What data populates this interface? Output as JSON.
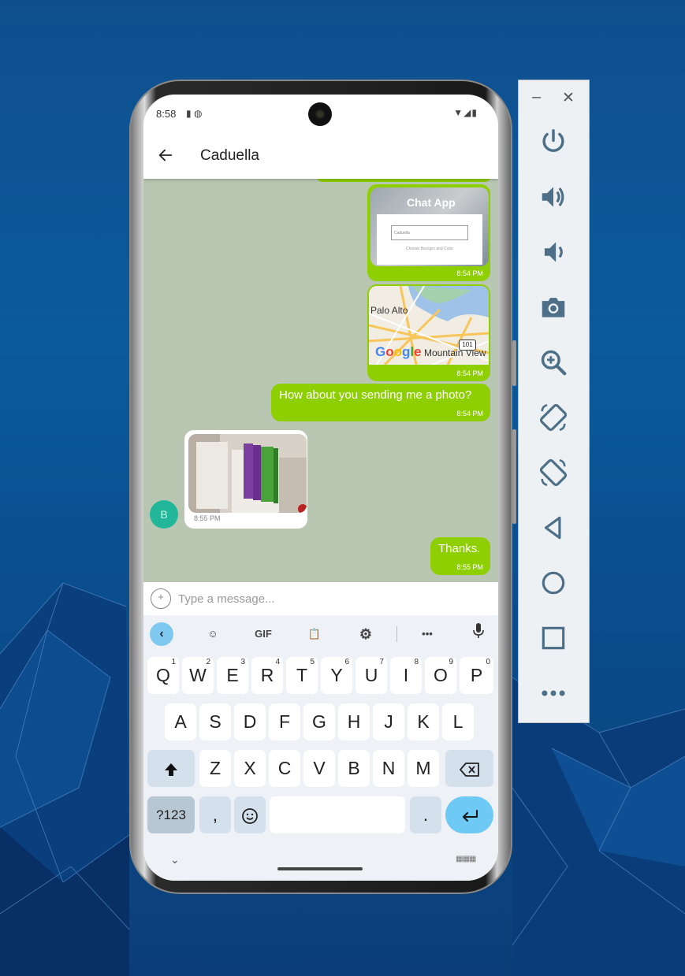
{
  "status_bar": {
    "time": "8:58"
  },
  "chat": {
    "title": "Caduella",
    "messages": [
      {
        "type": "image",
        "direction": "out",
        "caption_title": "Chat App",
        "caption_field": "Caduella",
        "caption_hint": "Choose Backgro and Color",
        "time": "8:54 PM"
      },
      {
        "type": "map",
        "direction": "out",
        "labels": [
          "Palo Alto",
          "Mountain View",
          "101",
          "Google"
        ],
        "time": "8:54 PM"
      },
      {
        "type": "text",
        "direction": "out",
        "text": "How about you sending me a photo?",
        "time": "8:54 PM"
      },
      {
        "type": "image",
        "direction": "in",
        "time": "8:55 PM"
      },
      {
        "type": "text",
        "direction": "out",
        "text": "Thanks.",
        "time": "8:55 PM"
      }
    ],
    "avatar_initial": "B"
  },
  "input": {
    "placeholder": "Type a message..."
  },
  "keyboard": {
    "toolbar": {
      "gif_label": "GIF"
    },
    "row1": [
      {
        "key": "Q",
        "hint": "1"
      },
      {
        "key": "W",
        "hint": "2"
      },
      {
        "key": "E",
        "hint": "3"
      },
      {
        "key": "R",
        "hint": "4"
      },
      {
        "key": "T",
        "hint": "5"
      },
      {
        "key": "Y",
        "hint": "6"
      },
      {
        "key": "U",
        "hint": "7"
      },
      {
        "key": "I",
        "hint": "8"
      },
      {
        "key": "O",
        "hint": "9"
      },
      {
        "key": "P",
        "hint": "0"
      }
    ],
    "row2": [
      "A",
      "S",
      "D",
      "F",
      "G",
      "H",
      "J",
      "K",
      "L"
    ],
    "row3": [
      "Z",
      "X",
      "C",
      "V",
      "B",
      "N",
      "M"
    ],
    "symbols_label": "?123",
    "comma_label": ",",
    "period_label": "."
  },
  "emulator_panel": {
    "buttons": [
      "power-icon",
      "volume-up-icon",
      "volume-down-icon",
      "camera-icon",
      "zoom-icon",
      "rotate-left-icon",
      "rotate-right-icon",
      "back-icon",
      "home-icon",
      "overview-icon",
      "more-icon"
    ]
  },
  "colors": {
    "bubble_out": "#8dcf00",
    "chat_bg": "#b9c7b2",
    "avatar": "#22b79a",
    "accent": "#6ec9f5"
  }
}
